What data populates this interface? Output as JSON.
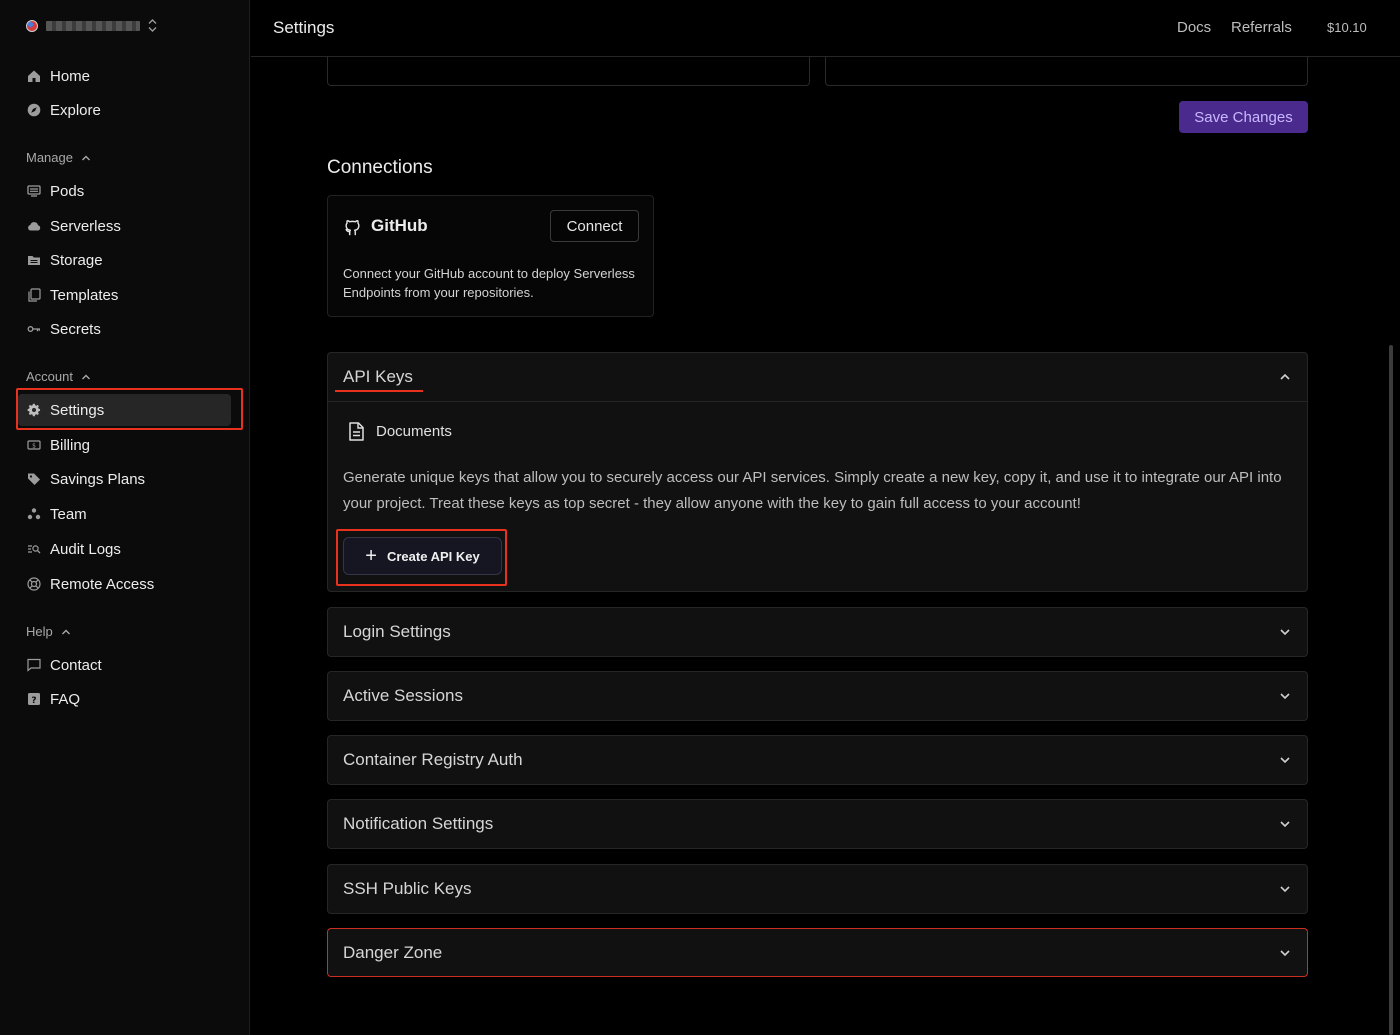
{
  "sidebar": {
    "workspace_switch_icon": "chevron-up-down-icon",
    "items_top": [
      {
        "label": "Home",
        "icon": "home-icon"
      },
      {
        "label": "Explore",
        "icon": "compass-icon"
      }
    ],
    "manage": {
      "label": "Manage",
      "items": [
        {
          "label": "Pods",
          "icon": "pods-icon"
        },
        {
          "label": "Serverless",
          "icon": "cloud-icon"
        },
        {
          "label": "Storage",
          "icon": "storage-icon"
        },
        {
          "label": "Templates",
          "icon": "templates-icon"
        },
        {
          "label": "Secrets",
          "icon": "key-icon"
        }
      ]
    },
    "account": {
      "label": "Account",
      "items": [
        {
          "label": "Settings",
          "icon": "gear-icon",
          "active": true
        },
        {
          "label": "Billing",
          "icon": "billing-icon"
        },
        {
          "label": "Savings Plans",
          "icon": "tag-icon"
        },
        {
          "label": "Team",
          "icon": "team-icon"
        },
        {
          "label": "Audit Logs",
          "icon": "audit-icon"
        },
        {
          "label": "Remote Access",
          "icon": "remote-icon"
        }
      ]
    },
    "help": {
      "label": "Help",
      "items": [
        {
          "label": "Contact",
          "icon": "chat-icon"
        },
        {
          "label": "FAQ",
          "icon": "question-icon"
        }
      ]
    }
  },
  "header": {
    "title": "Settings",
    "links": [
      "Docs",
      "Referrals"
    ],
    "balance": "$10.10"
  },
  "profile": {
    "save_label": "Save Changes",
    "save_color": "#4a2a8c"
  },
  "connections": {
    "title": "Connections",
    "github": {
      "name": "GitHub",
      "connect_label": "Connect",
      "description": "Connect your GitHub account to deploy Serverless Endpoints from your repositories."
    }
  },
  "api_keys": {
    "title": "API Keys",
    "docs_label": "Documents",
    "description": "Generate unique keys that allow you to securely access our API services. Simply create a new key, copy it, and use it to integrate our API into your project. Treat these keys as top secret - they allow anyone with the key to gain full access to your account!",
    "create_label": "Create API Key"
  },
  "sections": [
    {
      "title": "Login Settings"
    },
    {
      "title": "Active Sessions"
    },
    {
      "title": "Container Registry Auth"
    },
    {
      "title": "Notification Settings"
    },
    {
      "title": "SSH Public Keys"
    },
    {
      "title": "Danger Zone",
      "danger": true
    }
  ],
  "colors": {
    "highlight": "#e8321e",
    "danger_border": "#c9301f"
  }
}
